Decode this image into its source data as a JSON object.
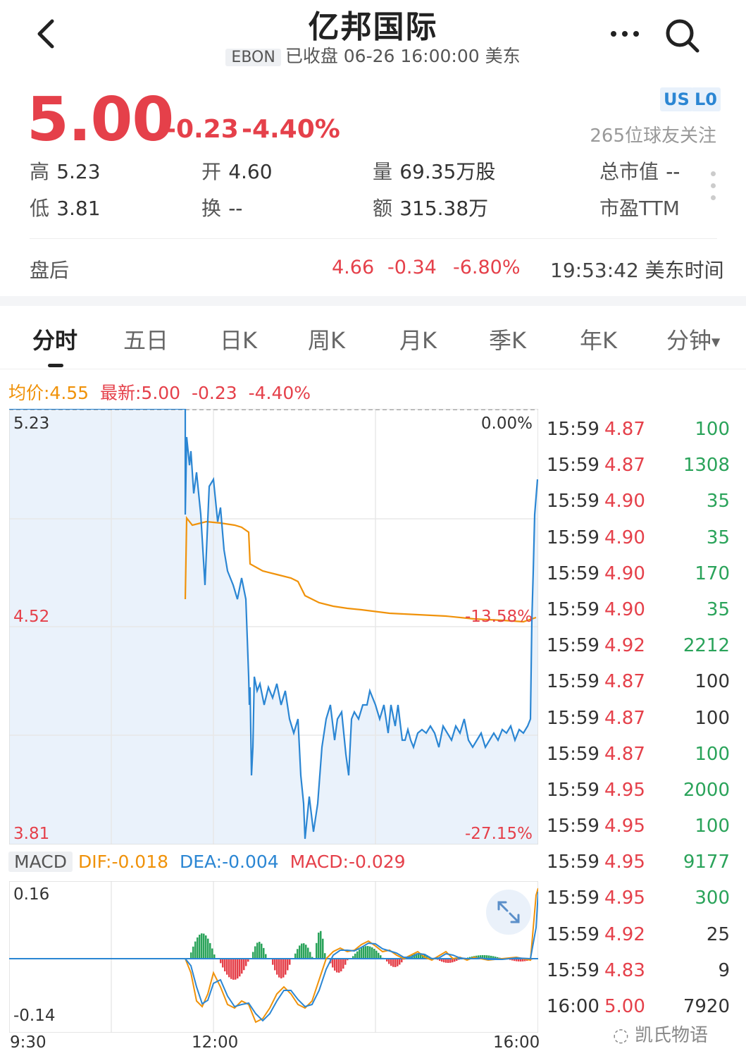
{
  "header": {
    "title": "亿邦国际",
    "ticker": "EBON",
    "status": "已收盘 06-26 16:00:00 美东"
  },
  "quote": {
    "price": "5.00",
    "change": "-0.23",
    "change_pct": "-4.40%",
    "market_tag": "US",
    "level_tag": "L0",
    "followers": "265位球友关注"
  },
  "stats": {
    "high_label": "高",
    "high": "5.23",
    "open_label": "开",
    "open": "4.60",
    "volume_label": "量",
    "volume": "69.35万股",
    "mktcap_label": "总市值",
    "mktcap": "--",
    "low_label": "低",
    "low": "3.81",
    "turnover_label": "换",
    "turnover": "--",
    "amount_label": "额",
    "amount": "315.38万",
    "pe_label": "市盈TTM",
    "pe": ""
  },
  "after_hours": {
    "label": "盘后",
    "price": "4.66",
    "change": "-0.34",
    "change_pct": "-6.80%",
    "time": "19:53:42 美东时间"
  },
  "tabs": [
    "分时",
    "五日",
    "日K",
    "周K",
    "月K",
    "季K",
    "年K",
    "分钟"
  ],
  "chart_info": {
    "avg": "均价:4.55",
    "latest": "最新:5.00",
    "change": "-0.23",
    "change_pct": "-4.40%"
  },
  "chart_labels": {
    "y_top": "5.23",
    "y_mid": "4.52",
    "y_bottom": "3.81",
    "pct_top": "0.00%",
    "pct_mid": "-13.58%",
    "pct_bottom": "-27.15%",
    "x_start": "9:30",
    "x_mid": "12:00",
    "x_end": "16:00"
  },
  "macd": {
    "label": "MACD",
    "dif": "DIF:-0.018",
    "dea": "DEA:-0.004",
    "macd": "MACD:-0.029",
    "y_top": "0.16",
    "y_bottom": "-0.14"
  },
  "trades": [
    {
      "time": "15:59",
      "price": "4.87",
      "vol": "100",
      "side": "buy"
    },
    {
      "time": "15:59",
      "price": "4.87",
      "vol": "1308",
      "side": "buy"
    },
    {
      "time": "15:59",
      "price": "4.90",
      "vol": "35",
      "side": "buy"
    },
    {
      "time": "15:59",
      "price": "4.90",
      "vol": "35",
      "side": "buy"
    },
    {
      "time": "15:59",
      "price": "4.90",
      "vol": "170",
      "side": "buy"
    },
    {
      "time": "15:59",
      "price": "4.90",
      "vol": "35",
      "side": "buy"
    },
    {
      "time": "15:59",
      "price": "4.92",
      "vol": "2212",
      "side": "buy"
    },
    {
      "time": "15:59",
      "price": "4.87",
      "vol": "100",
      "side": "neutral"
    },
    {
      "time": "15:59",
      "price": "4.87",
      "vol": "100",
      "side": "neutral"
    },
    {
      "time": "15:59",
      "price": "4.87",
      "vol": "100",
      "side": "buy"
    },
    {
      "time": "15:59",
      "price": "4.95",
      "vol": "2000",
      "side": "buy"
    },
    {
      "time": "15:59",
      "price": "4.95",
      "vol": "100",
      "side": "buy"
    },
    {
      "time": "15:59",
      "price": "4.95",
      "vol": "9177",
      "side": "buy"
    },
    {
      "time": "15:59",
      "price": "4.95",
      "vol": "300",
      "side": "buy"
    },
    {
      "time": "15:59",
      "price": "4.92",
      "vol": "25",
      "side": "neutral"
    },
    {
      "time": "15:59",
      "price": "4.83",
      "vol": "9",
      "side": "neutral"
    },
    {
      "time": "16:00",
      "price": "5.00",
      "vol": "7920",
      "side": "neutral"
    }
  ],
  "watermark": "凯氏物语",
  "colors": {
    "up": "#e5404a",
    "down": "#2aa35a",
    "price_line": "#2b86d3",
    "avg_line": "#f0920a"
  }
}
